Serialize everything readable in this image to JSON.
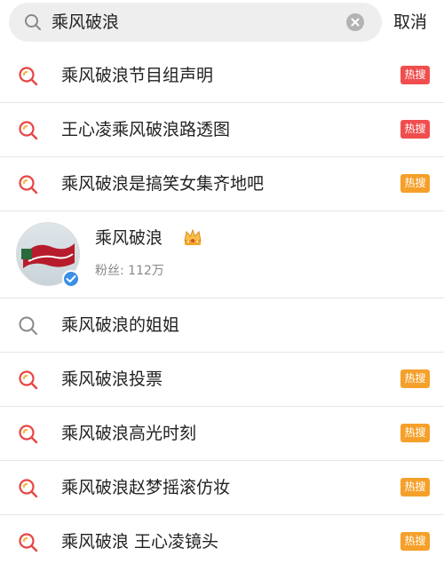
{
  "search": {
    "query": "乘风破浪",
    "cancel_label": "取消"
  },
  "colors": {
    "hot_red": "#f04e4e",
    "hot_orange": "#f5a02a",
    "trend_icon_red": "#e84545",
    "trend_icon_yellow": "#f5b63a"
  },
  "suggestions_top": [
    {
      "label": "乘风破浪节目组声明",
      "badge": "热搜",
      "badge_color": "red",
      "icon": "trending-search-icon"
    },
    {
      "label": "王心凌乘风破浪路透图",
      "badge": "热搜",
      "badge_color": "red",
      "icon": "trending-search-icon"
    },
    {
      "label": "乘风破浪是搞笑女集齐地吧",
      "badge": "热搜",
      "badge_color": "orange",
      "icon": "trending-search-icon"
    }
  ],
  "user": {
    "name": "乘风破浪",
    "followers": "粉丝: 112万",
    "avatar_text": "乘风破浪",
    "verified": true
  },
  "suggestions_bottom": [
    {
      "label": "乘风破浪的姐姐",
      "badge": "",
      "badge_color": "",
      "icon": "search-icon"
    },
    {
      "label": "乘风破浪投票",
      "badge": "热搜",
      "badge_color": "orange",
      "icon": "trending-search-icon"
    },
    {
      "label": "乘风破浪高光时刻",
      "badge": "热搜",
      "badge_color": "orange",
      "icon": "trending-search-icon"
    },
    {
      "label": "乘风破浪赵梦摇滚仿妆",
      "badge": "热搜",
      "badge_color": "orange",
      "icon": "trending-search-icon"
    },
    {
      "label": "乘风破浪 王心凌镜头",
      "badge": "热搜",
      "badge_color": "orange",
      "icon": "trending-search-icon"
    }
  ]
}
